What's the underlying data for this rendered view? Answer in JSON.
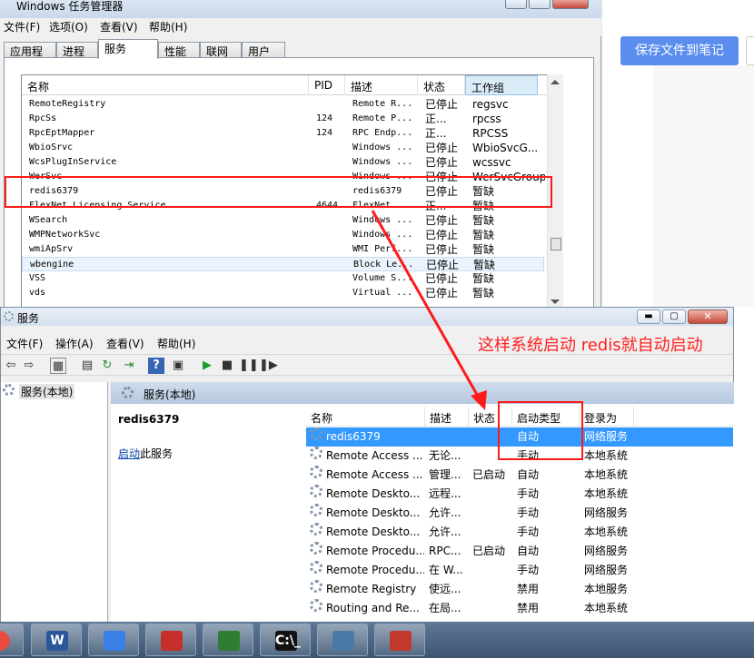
{
  "task_manager": {
    "title": "Windows 任务管理器",
    "menu": [
      "文件(F)",
      "选项(O)",
      "查看(V)",
      "帮助(H)"
    ],
    "tabs": [
      "应用程序",
      "进程",
      "服务",
      "性能",
      "联网",
      "用户"
    ],
    "active_tab": "服务",
    "columns": [
      "名称",
      "PID",
      "描述",
      "状态",
      "工作组"
    ],
    "rows": [
      {
        "name": "RemoteRegistry",
        "pid": "",
        "desc": "Remote R...",
        "status": "已停止",
        "group": "regsvc"
      },
      {
        "name": "RpcSs",
        "pid": "124",
        "desc": "Remote P...",
        "status": "正...",
        "group": "rpcss"
      },
      {
        "name": "RpcEptMapper",
        "pid": "124",
        "desc": "RPC Endp...",
        "status": "正...",
        "group": "RPCSS"
      },
      {
        "name": "WbioSrvc",
        "pid": "",
        "desc": "Windows ...",
        "status": "已停止",
        "group": "WbioSvcG..."
      },
      {
        "name": "WcsPlugInService",
        "pid": "",
        "desc": "Windows ...",
        "status": "已停止",
        "group": "wcssvc"
      },
      {
        "name": "WerSvc",
        "pid": "",
        "desc": "Windows ...",
        "status": "已停止",
        "group": "WerSvcGroup"
      },
      {
        "name": "redis6379",
        "pid": "",
        "desc": "redis6379",
        "status": "已停止",
        "group": "暂缺"
      },
      {
        "name": "FlexNet Licensing Service",
        "pid": "4644",
        "desc": "FlexNet...",
        "status": "正...",
        "group": "暂缺"
      },
      {
        "name": "WSearch",
        "pid": "",
        "desc": "Windows ...",
        "status": "已停止",
        "group": "暂缺"
      },
      {
        "name": "WMPNetworkSvc",
        "pid": "",
        "desc": "Windows ...",
        "status": "已停止",
        "group": "暂缺"
      },
      {
        "name": "wmiApSrv",
        "pid": "",
        "desc": "WMI Perf...",
        "status": "已停止",
        "group": "暂缺"
      },
      {
        "name": "wbengine",
        "pid": "",
        "desc": "Block Le...",
        "status": "已停止",
        "group": "暂缺"
      },
      {
        "name": "VSS",
        "pid": "",
        "desc": "Volume S...",
        "status": "已停止",
        "group": "暂缺"
      },
      {
        "name": "vds",
        "pid": "",
        "desc": "Virtual ...",
        "status": "已停止",
        "group": "暂缺"
      }
    ]
  },
  "services": {
    "title": "服务",
    "menu": [
      "文件(F)",
      "操作(A)",
      "查看(V)",
      "帮助(H)"
    ],
    "tree_item": "服务(本地)",
    "header": "服务(本地)",
    "selected_name": "redis6379",
    "start_link": "启动",
    "start_suffix": "此服务",
    "columns": [
      "名称",
      "描述",
      "状态",
      "启动类型",
      "登录为"
    ],
    "rows": [
      {
        "name": "redis6379",
        "desc": "",
        "status": "",
        "startup": "自动",
        "logon": "网络服务"
      },
      {
        "name": "Remote Access ...",
        "desc": "无论...",
        "status": "",
        "startup": "手动",
        "logon": "本地系统"
      },
      {
        "name": "Remote Access ...",
        "desc": "管理...",
        "status": "已启动",
        "startup": "自动",
        "logon": "本地系统"
      },
      {
        "name": "Remote Deskto...",
        "desc": "远程...",
        "status": "",
        "startup": "手动",
        "logon": "本地系统"
      },
      {
        "name": "Remote Deskto...",
        "desc": "允许...",
        "status": "",
        "startup": "手动",
        "logon": "网络服务"
      },
      {
        "name": "Remote Deskto...",
        "desc": "允许...",
        "status": "",
        "startup": "手动",
        "logon": "本地系统"
      },
      {
        "name": "Remote Procedu...",
        "desc": "RPC...",
        "status": "已启动",
        "startup": "自动",
        "logon": "网络服务"
      },
      {
        "name": "Remote Procedu...",
        "desc": "在 W...",
        "status": "",
        "startup": "手动",
        "logon": "网络服务"
      },
      {
        "name": "Remote Registry",
        "desc": "使远...",
        "status": "",
        "startup": "禁用",
        "logon": "本地服务"
      },
      {
        "name": "Routing and Re...",
        "desc": "在局...",
        "status": "",
        "startup": "禁用",
        "logon": "本地系统"
      }
    ]
  },
  "doc_panel": {
    "save_button": "保存文件到笔记"
  },
  "annotation": "这样系统启动 redis就自动启动",
  "taskbar": [
    {
      "icon": "chrome-icon",
      "label": ""
    },
    {
      "icon": "word-icon",
      "label": "W"
    },
    {
      "icon": "baidu-netdisk-icon",
      "label": ""
    },
    {
      "icon": "redis-icon",
      "label": ""
    },
    {
      "icon": "notepad-icon",
      "label": ""
    },
    {
      "icon": "cmd-icon",
      "label": "C:\\_"
    },
    {
      "icon": "network-icon",
      "label": ""
    },
    {
      "icon": "toolbox-icon",
      "label": ""
    }
  ],
  "colors": {
    "accent": "#3399ff",
    "annotation": "#ff1a1a",
    "save_button": "#5b8def"
  }
}
